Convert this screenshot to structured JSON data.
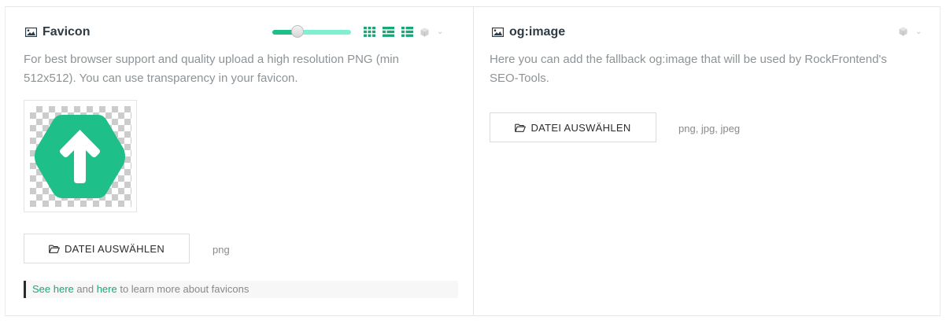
{
  "favicon": {
    "title": "Favicon",
    "description_line1": "For best browser support and quality upload a high resolution PNG (min",
    "description_line2": "512x512). You can use transparency in your favicon.",
    "upload_label": "DATEI AUSWÄHLEN",
    "extensions": "png",
    "notes": {
      "link1": "See here",
      "and": " and ",
      "link2": "here",
      "rest": " to learn more about favicons"
    },
    "thumbnail_size_level": 0.3
  },
  "ogimage": {
    "title": "og:image",
    "description_line1": "Here you can add the fallback og:image that will be used by RockFrontend's",
    "description_line2": "SEO-Tools.",
    "upload_label": "DATEI AUSWÄHLEN",
    "extensions": "png, jpg, jpeg"
  },
  "colors": {
    "accent": "#1da57a",
    "thumbnail": "#1fbf8a"
  },
  "icons": [
    "image-icon",
    "grid-view-icon",
    "list-view-icon",
    "detail-view-icon",
    "cube-icon",
    "chevron-down-icon",
    "folder-icon",
    "arrow-up-icon"
  ]
}
